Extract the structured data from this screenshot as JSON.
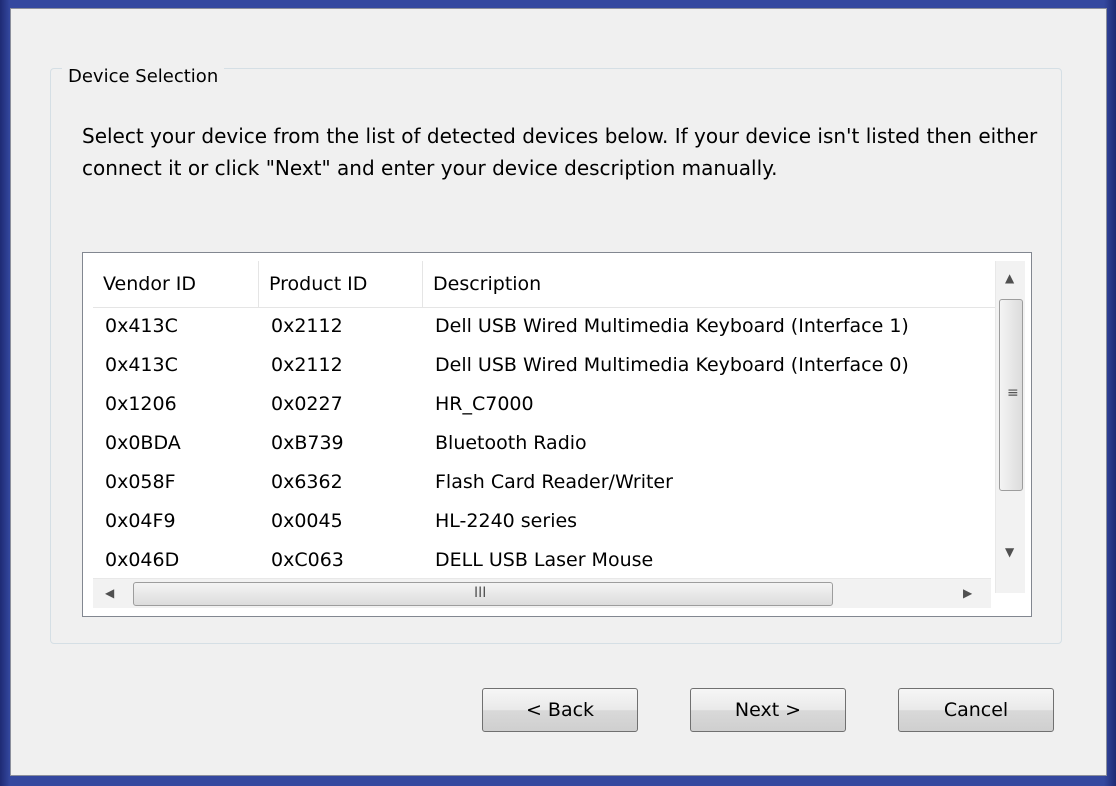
{
  "group": {
    "title": "Device Selection",
    "instructions": "Select your device from the list of detected devices below. If your device isn't listed then either connect it or click \"Next\" and enter your device description manually."
  },
  "table": {
    "columns": [
      "Vendor ID",
      "Product ID",
      "Description"
    ],
    "rows": [
      [
        "0x413C",
        "0x2112",
        "Dell USB Wired Multimedia Keyboard (Interface 1)"
      ],
      [
        "0x413C",
        "0x2112",
        "Dell USB Wired Multimedia Keyboard (Interface 0)"
      ],
      [
        "0x1206",
        "0x0227",
        "HR_C7000"
      ],
      [
        "0x0BDA",
        "0xB739",
        "Bluetooth Radio"
      ],
      [
        "0x058F",
        "0x6362",
        "Flash Card Reader/Writer"
      ],
      [
        "0x04F9",
        "0x0045",
        "HL-2240 series"
      ],
      [
        "0x046D",
        "0xC063",
        "DELL USB Laser Mouse"
      ]
    ]
  },
  "icons": {
    "scroll_up": "▲",
    "scroll_down": "▼",
    "scroll_left": "◀",
    "scroll_right": "▶",
    "v_grip": "≡",
    "h_grip": "III"
  },
  "buttons": {
    "back": "< Back",
    "next": "Next >",
    "cancel": "Cancel"
  }
}
